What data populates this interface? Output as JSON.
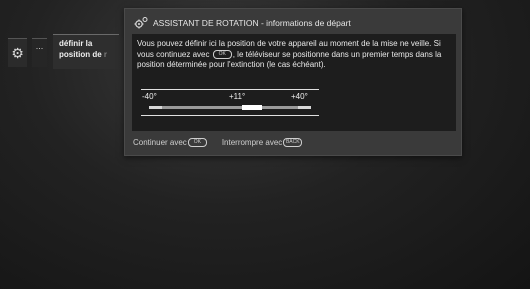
{
  "menu": {
    "item_label_line1": "définir la",
    "item_label_line2": "position de",
    "item_label_line2_faded": "r",
    "more_label": "..."
  },
  "dialog": {
    "title": "ASSISTANT DE ROTATION - informations de départ",
    "text_part1": "Vous pouvez définir ici la position de votre appareil au moment de la mise ne veille. Si vous continuez avec",
    "text_part2": ", le téléviseur se positionne dans un premier temps dans la position déterminée pour l'extinction (le cas échéant).",
    "key_ok_label": "OK",
    "slider": {
      "min_label": "-40°",
      "current_label": "+11°",
      "max_label": "+40°",
      "min": -40,
      "max": 40,
      "value": 11
    },
    "footer": {
      "continue_label": "Continuer avec",
      "continue_key": "OK",
      "cancel_label": "Interrompre avec",
      "cancel_key": "BACK"
    }
  },
  "colors": {
    "background": "#1c1c1c",
    "dialog": "#3a3a3a",
    "dialog_body": "#1d1d1d",
    "text": "#e8e8e8"
  }
}
